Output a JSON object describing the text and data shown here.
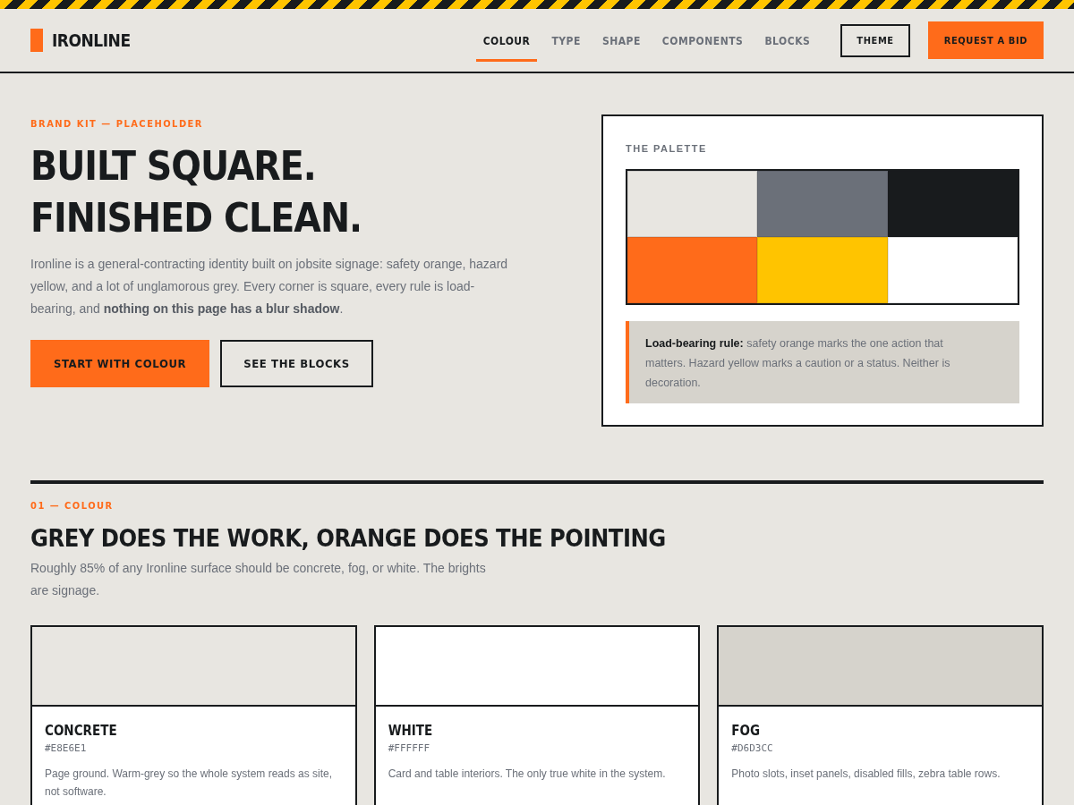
{
  "brand": {
    "name": "IRONLINE"
  },
  "nav": [
    {
      "label": "COLOUR",
      "selected": true
    },
    {
      "label": "TYPE",
      "selected": false
    },
    {
      "label": "SHAPE",
      "selected": false
    },
    {
      "label": "COMPONENTS",
      "selected": false
    },
    {
      "label": "BLOCKS",
      "selected": false
    }
  ],
  "header_buttons": [
    {
      "label": "THEME",
      "kind": "outline"
    },
    {
      "label": "REQUEST A BID",
      "kind": "primary"
    }
  ],
  "hero": {
    "eyebrow": "BRAND KIT — PLACEHOLDER",
    "title_lines": [
      "BUILT SQUARE.",
      "FINISHED CLEAN."
    ],
    "lede": "Ironline is a general-contracting identity built on jobsite signage: safety orange, hazard yellow, and a lot of unglamorous grey. Every corner is square, every rule is load-bearing, and **nothing on this page has a blur shadow**.",
    "buttons": [
      {
        "label": "START WITH COLOUR",
        "kind": "primary"
      },
      {
        "label": "SEE THE BLOCKS",
        "kind": "outline"
      }
    ]
  },
  "palette_card": {
    "title": "THE PALETTE",
    "swatches": [
      {
        "color": "#e8e6e1"
      },
      {
        "color": "#6b7079"
      },
      {
        "color": "#181b1d"
      },
      {
        "color": "#ff6b1a"
      },
      {
        "color": "#ffc400"
      },
      {
        "color": "#ffffff"
      }
    ],
    "note": "**Load-bearing rule:** safety orange marks the one action that matters. Hazard yellow marks a caution or a status. Neither is decoration."
  },
  "section": {
    "eyebrow": "01 — COLOUR",
    "title": "GREY DOES THE WORK, ORANGE DOES THE POINTING",
    "lede": "Roughly 85% of any Ironline surface should be concrete, fog, or white. The brights are signage.",
    "colors": [
      {
        "name": "CONCRETE",
        "hex": "#E8E6E1",
        "color": "#e8e6e1",
        "description": "Page ground. Warm-grey so the whole system reads as site, not software."
      },
      {
        "name": "WHITE",
        "hex": "#FFFFFF",
        "color": "#ffffff",
        "description": "Card and table interiors. The only true white in the system."
      },
      {
        "name": "FOG",
        "hex": "#D6D3CC",
        "color": "#d6d3cc",
        "description": "Photo slots, inset panels, disabled fills, zebra table rows."
      }
    ]
  }
}
